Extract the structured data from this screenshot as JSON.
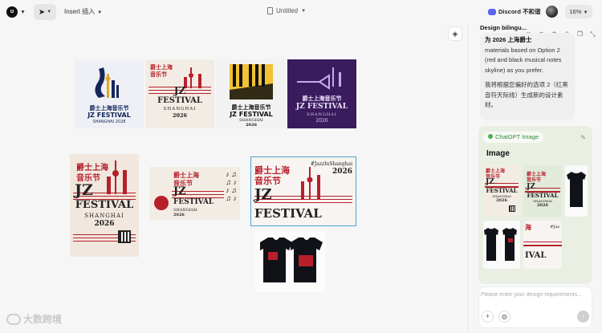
{
  "topbar": {
    "insert_label": "Insert 插入",
    "doc_title": "Untitled",
    "discord_label": "Discord 不和谐",
    "zoom": "16%"
  },
  "posters": {
    "p1": {
      "cn": "爵士上海音乐节",
      "title": "JZ FESTIVAL",
      "sub": "SHANGHAI 2028"
    },
    "p2": {
      "cn1": "爵士上海",
      "cn2": "音乐节",
      "jz": "JZ",
      "title": "FESTIVAL",
      "city": "SHANGHAI",
      "year": "2026"
    },
    "p3": {
      "cn": "爵士上海音乐节",
      "title": "JZ FESTIVAL",
      "city": "SHANGHAI",
      "year": "2026"
    },
    "p4": {
      "cn": "爵士上海音乐节",
      "title": "JZ FESTIVAL",
      "city": "SHANGHAI",
      "year": "2026"
    },
    "p5": {
      "cn1": "爵士上海",
      "cn2": "音乐节",
      "jz": "JZ",
      "title": "FESTIVAL",
      "city": "SHANGHAI",
      "year": "2026"
    },
    "p6": {
      "cn1": "爵士上海",
      "cn2": "音乐节",
      "jz": "JZ",
      "title": "FESTIVAL",
      "city": "SHANGHAI",
      "year": "2026"
    },
    "p7": {
      "cn1": "爵士上海",
      "cn2": "音乐节",
      "tag": "#JazzInShanghai",
      "year": "2026",
      "jz": "JZ",
      "title": "FESTIVAL"
    }
  },
  "panel": {
    "header": "Design bilingu...",
    "msg_line1": "为 2026 上海爵士",
    "msg_en": "materials based on Option 2 (red and black musical notes skyline) as you prefer.",
    "msg_cn": "我将根据您偏好的选项 2（红黑音符天际线）生成新的设计素材。",
    "gpt_tag": "ChatGPT Image",
    "gpt_title": "Image",
    "input_placeholder": "Please enter your design requirements...",
    "thumb1": {
      "cn1": "爵士上海",
      "cn2": "音乐节",
      "jz": "JZ",
      "title": "FESTIVAL",
      "city": "SHANGHAI",
      "year": "2026"
    },
    "thumb2": {
      "cn1": "爵士上海",
      "cn2": "音乐节",
      "jz": "JZ",
      "title": "FESTIVAL",
      "city": "SHANGHAI",
      "year": "2026"
    },
    "thumb5": {
      "cn": "海",
      "tag": "#Jaz",
      "title": "IVAL"
    }
  },
  "watermark": {
    "text": "大数跨境"
  },
  "colors": {
    "accent_red": "#b7202b",
    "navy": "#14265a",
    "purple": "#3a1c5e",
    "gpt_green": "#2f8a3b"
  }
}
